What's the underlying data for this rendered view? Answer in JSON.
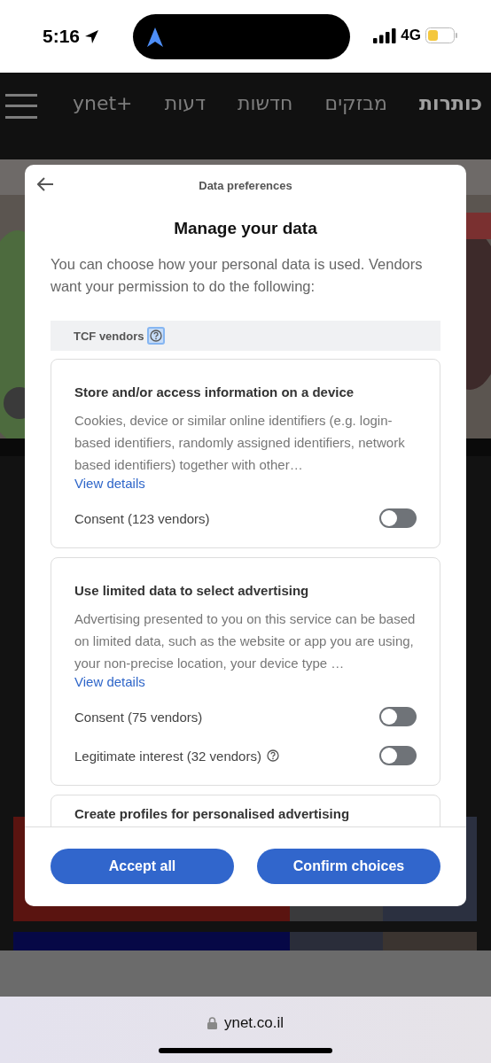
{
  "status_bar": {
    "time": "5:16",
    "network": "4G"
  },
  "nav": {
    "tabs": [
      {
        "label": "כותרות",
        "selected": true
      },
      {
        "label": "מבזקים",
        "selected": false
      },
      {
        "label": "חדשות",
        "selected": false
      },
      {
        "label": "דעות",
        "selected": false
      },
      {
        "label": "ynet+",
        "selected": false
      }
    ]
  },
  "dialog": {
    "header": "Data preferences",
    "title": "Manage your data",
    "intro": "You can choose how your personal data is used. Vendors want your permission to do the following:",
    "section": "TCF vendors",
    "purposes": [
      {
        "title": "Store and/or access information on a device",
        "description": "Cookies, device or similar online identifiers (e.g. login-based identifiers, randomly assigned identifiers, network based identifiers) together with other…",
        "link": "View details",
        "toggles": [
          {
            "label": "Consent (123 vendors)",
            "on": false,
            "help": false
          }
        ]
      },
      {
        "title": "Use limited data to select advertising",
        "description": "Advertising presented to you on this service can be based on limited data, such as the website or app you are using, your non-precise location, your device type …",
        "link": "View details",
        "toggles": [
          {
            "label": "Consent (75 vendors)",
            "on": false,
            "help": false
          },
          {
            "label": "Legitimate interest (32 vendors)",
            "on": false,
            "help": true
          }
        ]
      },
      {
        "title": "Create profiles for personalised advertising"
      }
    ],
    "buttons": [
      "Accept all",
      "Confirm choices"
    ]
  },
  "browser": {
    "url": "ynet.co.il"
  }
}
